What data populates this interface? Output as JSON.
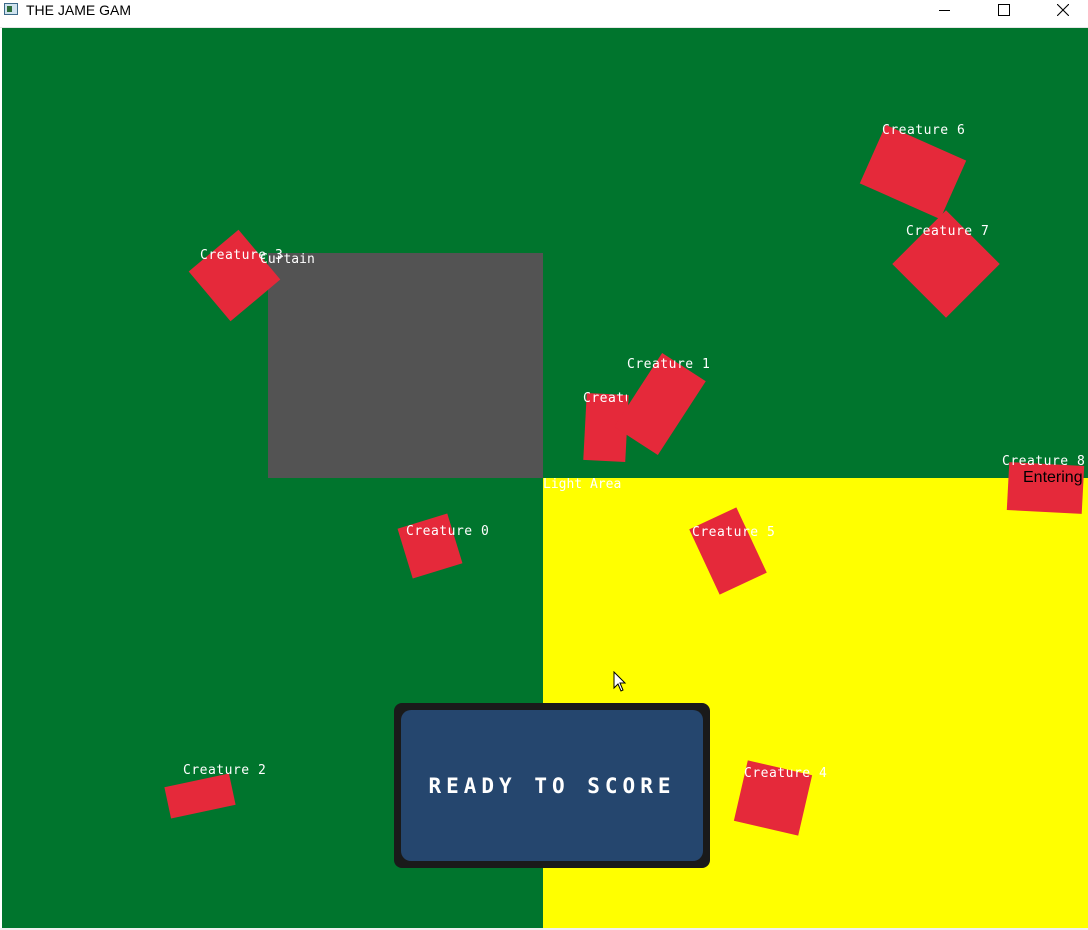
{
  "window": {
    "title": "THE JAME GAM",
    "app_icon": "app-window-icon",
    "controls": [
      "minimize-icon",
      "maximize-icon",
      "close-icon"
    ]
  },
  "colors": {
    "field": "#00752d",
    "curtain": "#535353",
    "light_area": "#ffff00",
    "creature": "#e5293a",
    "button": "#25466e",
    "button_frame": "#1a1a1a"
  },
  "zones": {
    "curtain_label": "Curtain",
    "light_label": "Light Area"
  },
  "creatures": [
    {
      "label": "Creature 0"
    },
    {
      "label": "Creature 1"
    },
    {
      "label": "Creature 2"
    },
    {
      "label": "Creature 3"
    },
    {
      "label": "Creature 4"
    },
    {
      "label": "Creature 5"
    },
    {
      "label": "Creature 6"
    },
    {
      "label": "Creature 7"
    },
    {
      "label": "Creature 8",
      "status": "Entering"
    },
    {
      "label": "Creature 9"
    }
  ],
  "score_button": {
    "label": "READY TO SCORE"
  }
}
